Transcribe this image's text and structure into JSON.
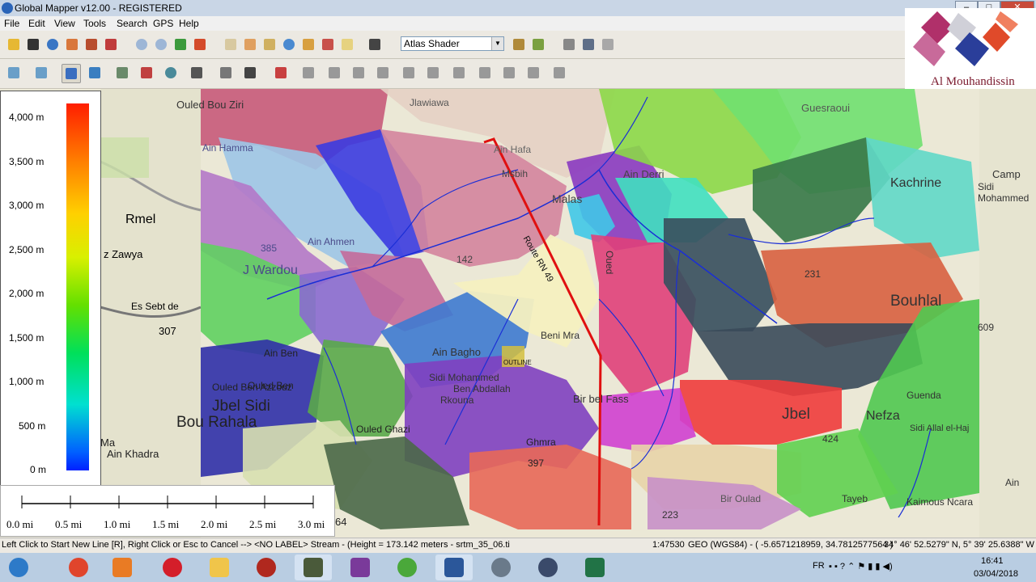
{
  "window": {
    "title": "Global Mapper v12.00 - REGISTERED",
    "controls": {
      "minimize": "–",
      "maximize": "□",
      "close": "✕"
    }
  },
  "menu": [
    "File",
    "Edit",
    "View",
    "Tools",
    "Search",
    "GPS",
    "Help"
  ],
  "toolbar": {
    "shader": "Atlas Shader"
  },
  "logo": {
    "text": "Al Mouhandissin"
  },
  "legend": {
    "title": "",
    "labels": [
      "4,000 m",
      "3,500 m",
      "3,000 m",
      "2,500 m",
      "2,000 m",
      "1,500 m",
      "1,000 m",
      "500 m",
      "0 m"
    ]
  },
  "scale_bar": {
    "labels": [
      "0.0 mi",
      "0.5 mi",
      "1.0 mi",
      "1.5 mi",
      "2.0 mi",
      "2.5 mi",
      "3.0 mi"
    ]
  },
  "map": {
    "place_labels": [
      "Rmel",
      "z Zawya",
      "Es Sebt de",
      "307",
      "J Wardou",
      "Ain Hamma",
      "Ouled Bou Ziri",
      "Jlawiawa",
      "Ain Hafa",
      "Msbih",
      "Malas",
      "Ain Derri",
      "Guesraoui",
      "Camp",
      "Sidi Mohammed",
      "Kachrine",
      "Route RN 49",
      "142",
      "Ain Ahmen",
      "385",
      "Ain Bagho",
      "Sidi Mohammed",
      "Ben Abdallah",
      "Rkouna",
      "Bir bel Fass",
      "Bouhlal",
      "609",
      "Jbel",
      "Nefza",
      "Guenda",
      "Sidi Allal el-Haj",
      "Ouled Ben",
      "Jbel Sidi",
      "Bou Rahala",
      "Ain Khadra",
      "Ouled Ghazi",
      "Ghmra",
      "397",
      "Bir Oulad",
      "Tayeb",
      "Kaimous Ncara",
      "Ain",
      "Ouled Ben Azzouz",
      "Beni Mra",
      "231",
      "424",
      "223",
      "Ain Ben",
      "Ma",
      "64",
      "Oued"
    ],
    "point_label": "OUTLINE"
  },
  "status": {
    "message": "Left Click to Start New Line [R], Right Click or Esc to Cancel --> <NO LABEL> Stream - (Height = 173.142 meters - srtm_35_06.ti",
    "scale": "1:47530",
    "coords": "GEO (WGS84) - ( -5.6571218959, 34.7812577564 )",
    "dms": "34° 46' 52.5279\" N, 5° 39' 25.6388\" W"
  },
  "taskbar": {
    "apps": [
      "start",
      "chrome",
      "media-player",
      "opera",
      "file-explorer",
      "antivirus",
      "global-mapper",
      "winrar",
      "utorrent",
      "word",
      "explorer-globe",
      "world-map",
      "excel"
    ],
    "tray": {
      "lang": "FR",
      "time": "16:41",
      "date": "03/04/2018"
    }
  },
  "colors": {
    "title_bg": "#c9d6e6",
    "route": "#e01010",
    "stream": "#1a2ed6",
    "taskbar": "#b9cde2"
  }
}
